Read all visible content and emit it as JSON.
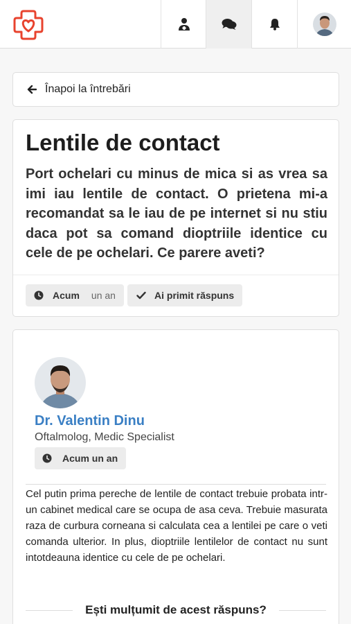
{
  "header": {
    "logo": "heart-cross-logo",
    "nav": [
      {
        "icon": "doctor-icon"
      },
      {
        "icon": "chat-icon",
        "active": true
      },
      {
        "icon": "bell-icon"
      },
      {
        "icon": "user-avatar"
      }
    ]
  },
  "back": {
    "label": "Înapoi la întrebări",
    "icon": "arrow-left-icon"
  },
  "question": {
    "title": "Lentile de contact",
    "body": "Port ochelari cu minus de mica si as vrea sa imi iau lentile de contact. O prietena mi-a recomandat sa le iau de pe internet si nu stiu daca pot sa comand dioptriile identice cu cele de pe ochelari. Ce parere aveti?",
    "time_label": "Acum",
    "time_value": "un an",
    "answered_label": "Ai primit răspuns"
  },
  "answer": {
    "doctor_name": "Dr. Valentin Dinu",
    "doctor_specialty": "Oftalmolog, Medic Specialist",
    "time": "Acum un an",
    "body": "Cel putin prima pereche de lentile de contact trebuie probata intr-un cabinet medical care se ocupa de asa ceva. Trebuie masurata raza de curbura corneana si calculata cea a lentilei pe care o veti comanda ulterior. In plus, dioptriile lentilelor de contact nu sunt intotdeauna identice cu cele de pe ochelari.",
    "feedback_prompt": "Ești mulțumit de acest răspuns?"
  },
  "colors": {
    "brand": "#e8432e",
    "link": "#3a7fc4"
  }
}
